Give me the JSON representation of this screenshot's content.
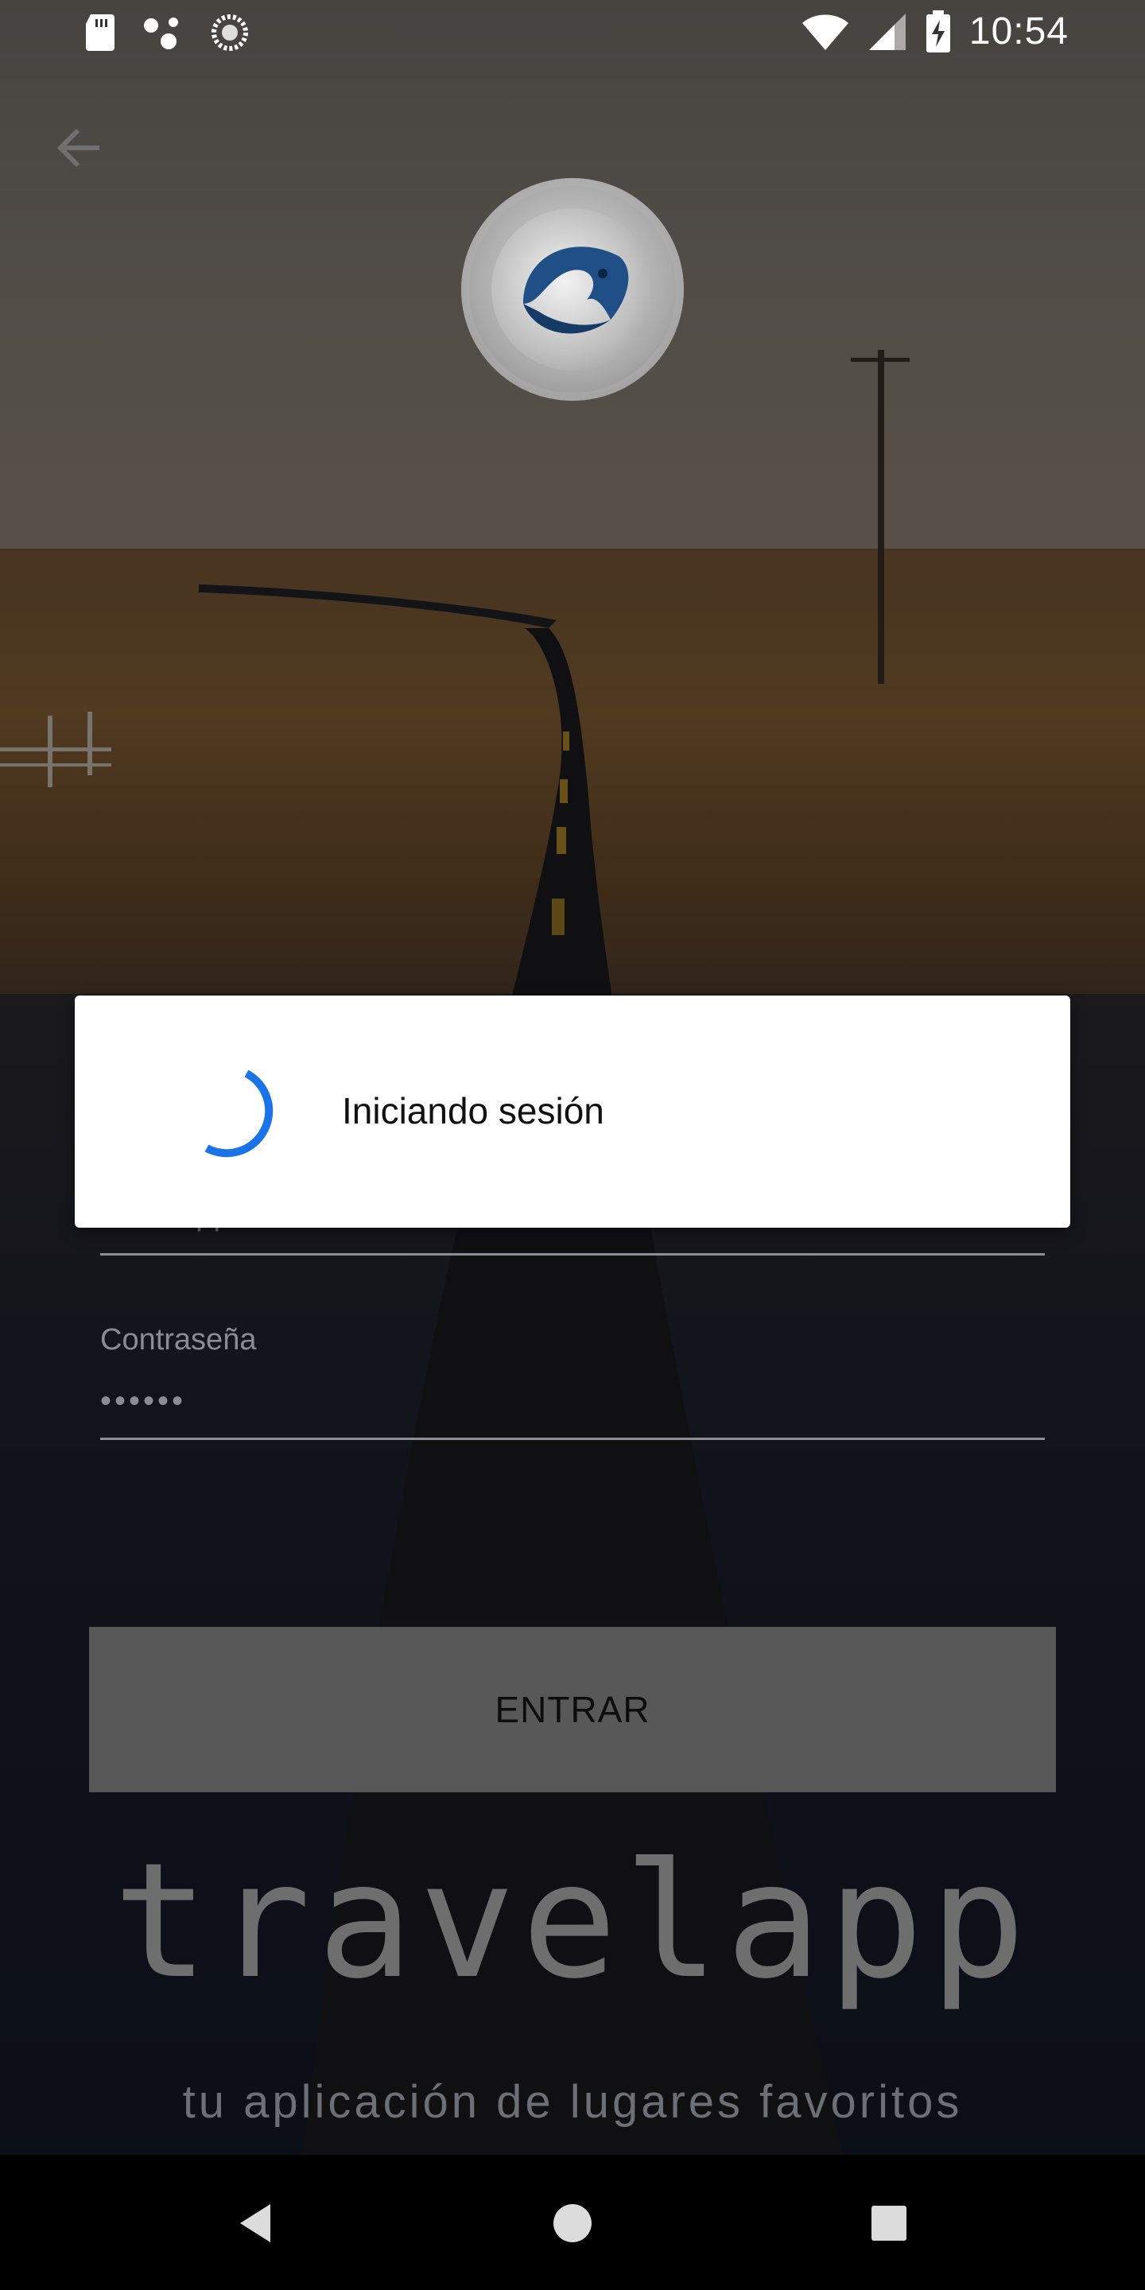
{
  "status_bar": {
    "time": "10:54",
    "left_icons": [
      "sd-card-icon",
      "assistant-dots-icon",
      "sync-icon"
    ],
    "right_icons": [
      "wifi-icon",
      "signal-icon",
      "battery-charging-icon"
    ]
  },
  "header": {
    "back_icon": "arrow-back-icon",
    "logo": "app-logo"
  },
  "form": {
    "username_value": "travelapp",
    "password_label": "Contraseña",
    "password_value": "••••••"
  },
  "button": {
    "login_label": "ENTRAR"
  },
  "brand": {
    "name": "travelapp",
    "tagline": "tu aplicación de lugares favoritos"
  },
  "dialog": {
    "message": "Iniciando sesión",
    "spinner_color": "#1a73e8"
  },
  "nav_bar": {
    "icons": [
      "back-triangle-icon",
      "home-circle-icon",
      "recents-square-icon"
    ]
  }
}
